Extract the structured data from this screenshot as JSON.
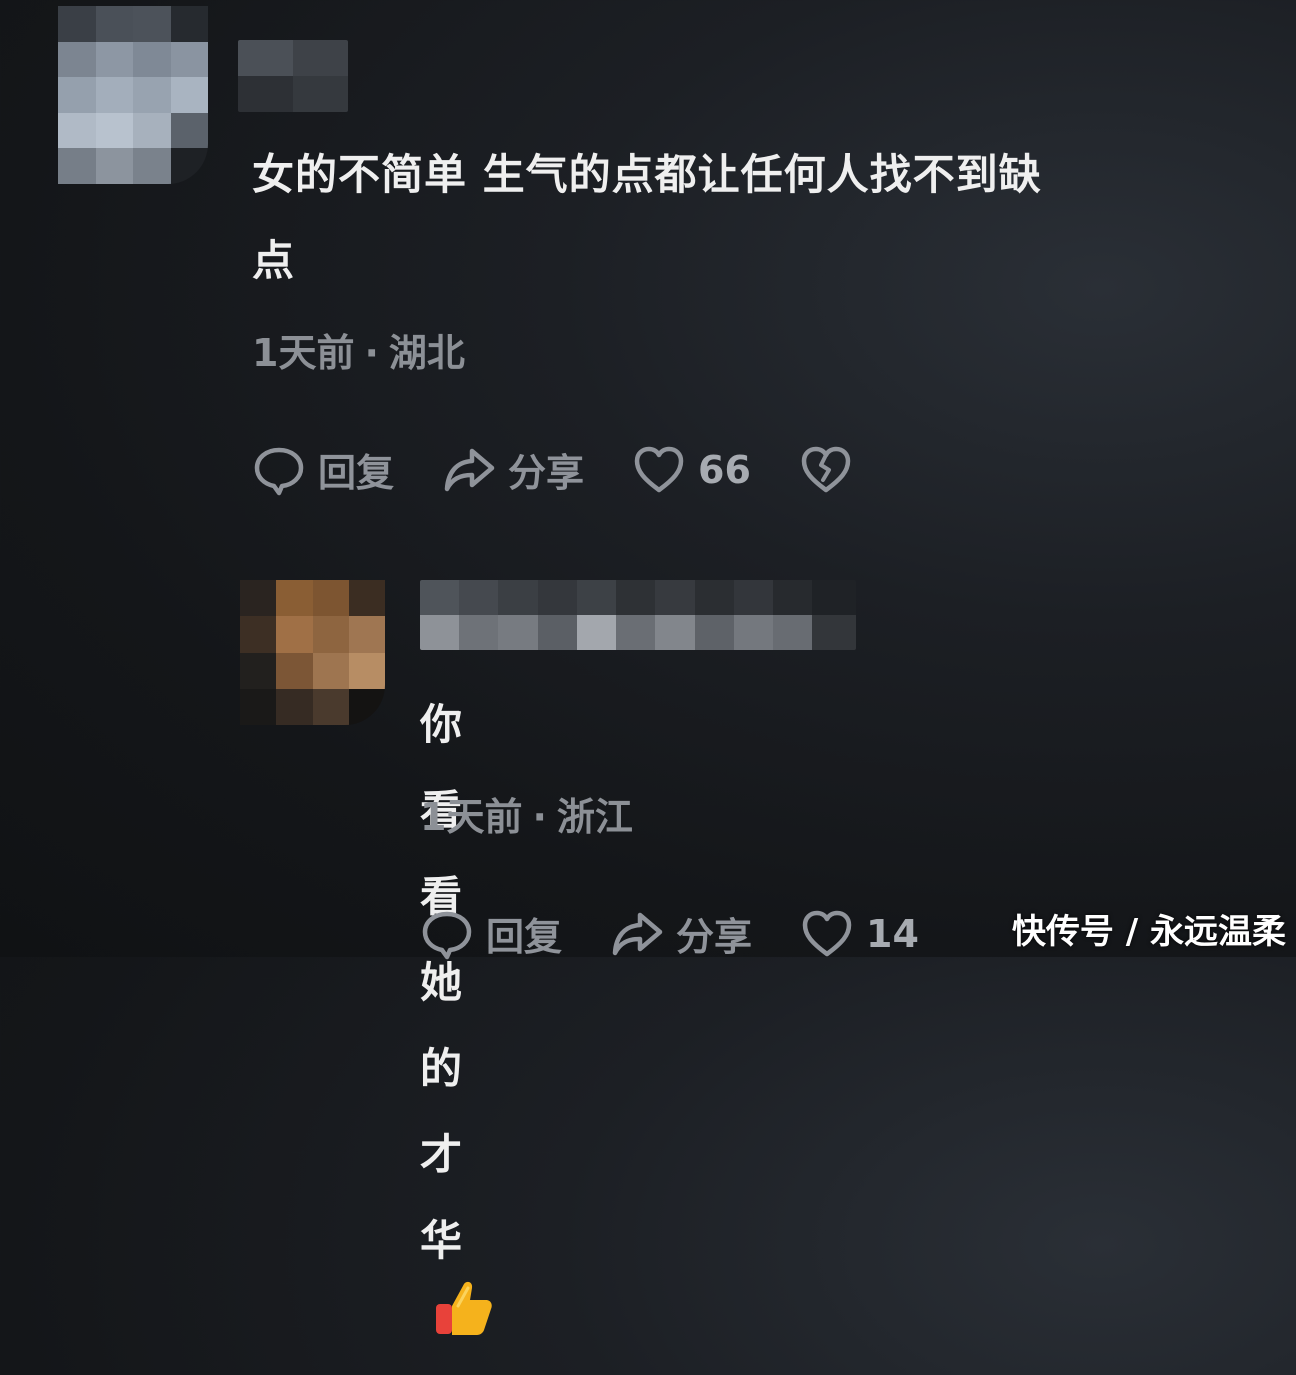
{
  "comments": [
    {
      "text_line1": "女的不简单 生气的点都让任何人找不到缺",
      "text_line2": "点",
      "time": "1天前",
      "dot": "·",
      "location": "湖北",
      "actions": {
        "reply_label": "回复",
        "share_label": "分享",
        "like_count": "66"
      }
    },
    {
      "text": "你看看她的才华",
      "emoji": "thumbs-up",
      "time": "1天前",
      "dot": "·",
      "location": "浙江",
      "actions": {
        "reply_label": "回复",
        "share_label": "分享",
        "like_count": "14"
      }
    }
  ],
  "watermark": "快传号 / 永远温柔",
  "colors": {
    "background": "#16181b",
    "text": "#efefef",
    "meta": "#8c9096",
    "icon": "#8f939a"
  }
}
